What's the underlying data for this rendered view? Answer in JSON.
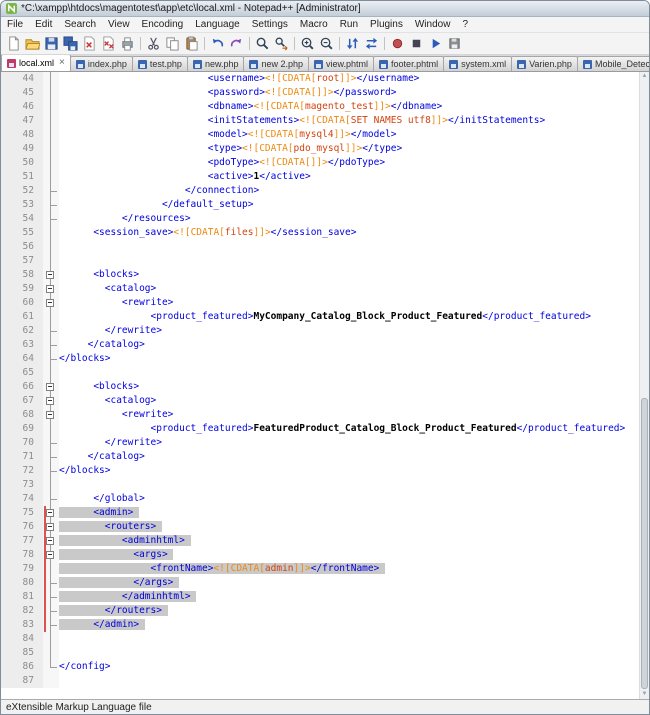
{
  "window": {
    "title": "*C:\\xampp\\htdocs\\magentotest\\app\\etc\\local.xml - Notepad++ [Administrator]"
  },
  "menu_bar": {
    "items": [
      "File",
      "Edit",
      "Search",
      "View",
      "Encoding",
      "Language",
      "Settings",
      "Macro",
      "Run",
      "Plugins",
      "Window",
      "?"
    ]
  },
  "toolbar": {
    "groups": [
      [
        "new-file",
        "open-file",
        "save-file",
        "save-all",
        "close-file",
        "close-all",
        "print"
      ],
      [
        "cut",
        "copy",
        "paste"
      ],
      [
        "undo",
        "redo"
      ],
      [
        "find",
        "replace"
      ],
      [
        "zoom-in",
        "zoom-out"
      ],
      [
        "sync-vertical",
        "sync-horizontal"
      ],
      [
        "macro-record",
        "macro-stop",
        "macro-play",
        "macro-save"
      ]
    ]
  },
  "tabs": [
    {
      "label": "local.xml",
      "active": true,
      "modified": true
    },
    {
      "label": "index.php"
    },
    {
      "label": "test.php"
    },
    {
      "label": "new.php"
    },
    {
      "label": "new 2.php"
    },
    {
      "label": "view.phtml"
    },
    {
      "label": "footer.phtml"
    },
    {
      "label": "system.xml"
    },
    {
      "label": "Varien.php"
    },
    {
      "label": "Mobile_Detect.php"
    }
  ],
  "editor": {
    "first_visible_line": 44,
    "last_visible_line": 87,
    "selection_lines": [
      75,
      83
    ],
    "lines": [
      {
        "n": 44,
        "i": 26,
        "f": "line",
        "segs": [
          [
            "t",
            "<username>"
          ],
          [
            "c",
            "<![CDATA["
          ],
          [
            "v",
            "root"
          ],
          [
            "c",
            "]]>"
          ],
          [
            "t",
            "</username>"
          ]
        ]
      },
      {
        "n": 45,
        "i": 26,
        "f": "line",
        "segs": [
          [
            "t",
            "<password>"
          ],
          [
            "c",
            "<![CDATA[]]>"
          ],
          [
            "t",
            "</password>"
          ]
        ]
      },
      {
        "n": 46,
        "i": 26,
        "f": "line",
        "segs": [
          [
            "t",
            "<dbname>"
          ],
          [
            "c",
            "<![CDATA["
          ],
          [
            "v",
            "magento_test"
          ],
          [
            "c",
            "]]>"
          ],
          [
            "t",
            "</dbname>"
          ]
        ]
      },
      {
        "n": 47,
        "i": 26,
        "f": "line",
        "segs": [
          [
            "t",
            "<initStatements>"
          ],
          [
            "c",
            "<![CDATA["
          ],
          [
            "v",
            "SET NAMES utf8"
          ],
          [
            "c",
            "]]>"
          ],
          [
            "t",
            "</initStatements>"
          ]
        ]
      },
      {
        "n": 48,
        "i": 26,
        "f": "line",
        "segs": [
          [
            "t",
            "<model>"
          ],
          [
            "c",
            "<![CDATA["
          ],
          [
            "v",
            "mysql4"
          ],
          [
            "c",
            "]]>"
          ],
          [
            "t",
            "</model>"
          ]
        ]
      },
      {
        "n": 49,
        "i": 26,
        "f": "line",
        "segs": [
          [
            "t",
            "<type>"
          ],
          [
            "c",
            "<![CDATA["
          ],
          [
            "v",
            "pdo_mysql"
          ],
          [
            "c",
            "]]>"
          ],
          [
            "t",
            "</type>"
          ]
        ]
      },
      {
        "n": 50,
        "i": 26,
        "f": "line",
        "segs": [
          [
            "t",
            "<pdoType>"
          ],
          [
            "c",
            "<![CDATA[]]>"
          ],
          [
            "t",
            "</pdoType>"
          ]
        ]
      },
      {
        "n": 51,
        "i": 26,
        "f": "line",
        "segs": [
          [
            "t",
            "<active>"
          ],
          [
            "b",
            "1"
          ],
          [
            "t",
            "</active>"
          ]
        ]
      },
      {
        "n": 52,
        "i": 22,
        "f": "tee",
        "segs": [
          [
            "t",
            "</connection>"
          ]
        ]
      },
      {
        "n": 53,
        "i": 18,
        "f": "tee",
        "segs": [
          [
            "t",
            "</default_setup>"
          ]
        ]
      },
      {
        "n": 54,
        "i": 11,
        "f": "tee",
        "segs": [
          [
            "t",
            "</resources>"
          ]
        ]
      },
      {
        "n": 55,
        "i": 6,
        "f": "line",
        "segs": [
          [
            "t",
            "<session_save>"
          ],
          [
            "c",
            "<![CDATA["
          ],
          [
            "v",
            "files"
          ],
          [
            "c",
            "]]>"
          ],
          [
            "t",
            "</session_save>"
          ]
        ]
      },
      {
        "n": 56,
        "i": 0,
        "f": "line",
        "segs": []
      },
      {
        "n": 57,
        "i": 0,
        "f": "line",
        "segs": []
      },
      {
        "n": 58,
        "i": 6,
        "f": "box",
        "segs": [
          [
            "t",
            "<blocks>"
          ]
        ]
      },
      {
        "n": 59,
        "i": 8,
        "f": "box",
        "segs": [
          [
            "t",
            "<catalog>"
          ]
        ]
      },
      {
        "n": 60,
        "i": 11,
        "f": "box",
        "segs": [
          [
            "t",
            "<rewrite>"
          ]
        ]
      },
      {
        "n": 61,
        "i": 16,
        "f": "line",
        "segs": [
          [
            "t",
            "<product_featured>"
          ],
          [
            "b",
            "MyCompany_Catalog_Block_Product_Featured"
          ],
          [
            "t",
            "</product_featured>"
          ]
        ]
      },
      {
        "n": 62,
        "i": 8,
        "f": "tee",
        "segs": [
          [
            "t",
            "</rewrite>"
          ]
        ]
      },
      {
        "n": 63,
        "i": 5,
        "f": "tee",
        "segs": [
          [
            "t",
            "</catalog>"
          ]
        ]
      },
      {
        "n": 64,
        "i": 0,
        "f": "tee",
        "segs": [
          [
            "t",
            "</blocks>"
          ]
        ]
      },
      {
        "n": 65,
        "i": 0,
        "f": "line",
        "segs": []
      },
      {
        "n": 66,
        "i": 6,
        "f": "box",
        "segs": [
          [
            "t",
            "<blocks>"
          ]
        ]
      },
      {
        "n": 67,
        "i": 8,
        "f": "box",
        "segs": [
          [
            "t",
            "<catalog>"
          ]
        ]
      },
      {
        "n": 68,
        "i": 11,
        "f": "box",
        "segs": [
          [
            "t",
            "<rewrite>"
          ]
        ]
      },
      {
        "n": 69,
        "i": 16,
        "f": "line",
        "segs": [
          [
            "t",
            "<product_featured>"
          ],
          [
            "b",
            "FeaturedProduct_Catalog_Block_Product_Featured"
          ],
          [
            "t",
            "</product_featured>"
          ]
        ]
      },
      {
        "n": 70,
        "i": 8,
        "f": "tee",
        "segs": [
          [
            "t",
            "</rewrite>"
          ]
        ]
      },
      {
        "n": 71,
        "i": 5,
        "f": "tee",
        "segs": [
          [
            "t",
            "</catalog>"
          ]
        ]
      },
      {
        "n": 72,
        "i": 0,
        "f": "tee",
        "segs": [
          [
            "t",
            "</blocks>"
          ]
        ]
      },
      {
        "n": 73,
        "i": 0,
        "f": "line",
        "segs": []
      },
      {
        "n": 74,
        "i": 6,
        "f": "tee",
        "segs": [
          [
            "t",
            "</global>"
          ]
        ]
      },
      {
        "n": 75,
        "i": 6,
        "f": "box",
        "sel": true,
        "segs": [
          [
            "t",
            "<admin>"
          ]
        ]
      },
      {
        "n": 76,
        "i": 8,
        "f": "box",
        "sel": true,
        "segs": [
          [
            "t",
            "<routers>"
          ]
        ]
      },
      {
        "n": 77,
        "i": 11,
        "f": "box",
        "sel": true,
        "segs": [
          [
            "t",
            "<adminhtml>"
          ]
        ]
      },
      {
        "n": 78,
        "i": 13,
        "f": "box",
        "sel": true,
        "segs": [
          [
            "t",
            "<args>"
          ]
        ]
      },
      {
        "n": 79,
        "i": 16,
        "f": "line",
        "sel": true,
        "segs": [
          [
            "t",
            "<frontName>"
          ],
          [
            "c",
            "<![CDATA["
          ],
          [
            "v",
            "admin"
          ],
          [
            "c",
            "]]>"
          ],
          [
            "t",
            "</frontName>"
          ]
        ]
      },
      {
        "n": 80,
        "i": 13,
        "f": "tee",
        "sel": true,
        "segs": [
          [
            "t",
            "</args>"
          ]
        ]
      },
      {
        "n": 81,
        "i": 11,
        "f": "tee",
        "sel": true,
        "segs": [
          [
            "t",
            "</adminhtml>"
          ]
        ]
      },
      {
        "n": 82,
        "i": 8,
        "f": "tee",
        "sel": true,
        "segs": [
          [
            "t",
            "</routers>"
          ]
        ]
      },
      {
        "n": 83,
        "i": 6,
        "f": "tee",
        "sel": true,
        "segs": [
          [
            "t",
            "</admin>"
          ]
        ]
      },
      {
        "n": 84,
        "i": 0,
        "f": "line",
        "segs": []
      },
      {
        "n": 85,
        "i": 0,
        "f": "line",
        "segs": []
      },
      {
        "n": 86,
        "i": 0,
        "f": "end",
        "segs": [
          [
            "t",
            "</config>"
          ]
        ]
      },
      {
        "n": 87,
        "i": 0,
        "f": "",
        "segs": []
      }
    ]
  },
  "status_bar": {
    "text": "eXtensible Markup Language file"
  },
  "colors": {
    "tag": "#0202dd",
    "cdata": "#ec8a12",
    "cdata_value": "#d2430e",
    "selection": "#c9c9c9",
    "modified_disk": "#c03a6a",
    "saved_disk": "#3a66b0"
  }
}
